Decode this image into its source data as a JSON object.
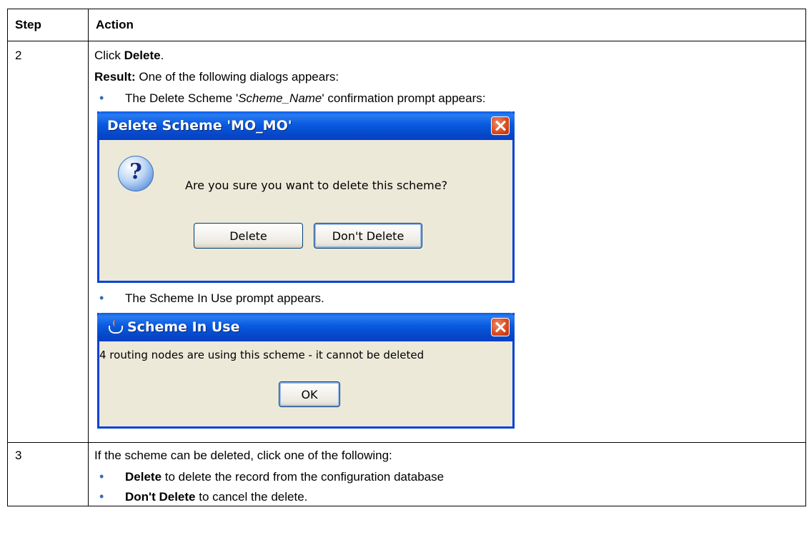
{
  "table": {
    "headers": [
      "Step",
      "Action"
    ],
    "row2": {
      "step": "2",
      "line1_pre": "Click ",
      "line1_bold": "Delete",
      "line1_post": ".",
      "line2_bold": "Result:",
      "line2_text": " One of the following dialogs appears:",
      "bullet1_pre": "The Delete Scheme '",
      "bullet1_italic": "Scheme_Name",
      "bullet1_post": "' confirmation prompt appears:",
      "bullet2": "The Scheme In Use prompt appears."
    },
    "row3": {
      "step": "3",
      "intro": "If the scheme can be deleted, click one of the following:",
      "bullet1_bold": "Delete",
      "bullet1_text": " to delete the record from the configuration database",
      "bullet2_bold": "Don't Delete",
      "bullet2_text": " to cancel the delete."
    }
  },
  "dialog_delete": {
    "title": "Delete Scheme 'MO_MO'",
    "message": "Are you sure you want to delete this scheme?",
    "button_delete": "Delete",
    "button_dont_delete": "Don't Delete",
    "icon": "question-icon",
    "close_icon": "close-icon"
  },
  "dialog_in_use": {
    "title": "Scheme In Use",
    "message": "4 routing nodes are using this scheme - it cannot be deleted",
    "button_ok": "OK",
    "icon": "java-icon",
    "close_icon": "close-icon"
  },
  "colors": {
    "xp_title_blue": "#0a5ae8",
    "xp_dialog_bg": "#ece9d8",
    "close_red": "#d94a1c",
    "bullet_blue": "#3a6fb0"
  }
}
